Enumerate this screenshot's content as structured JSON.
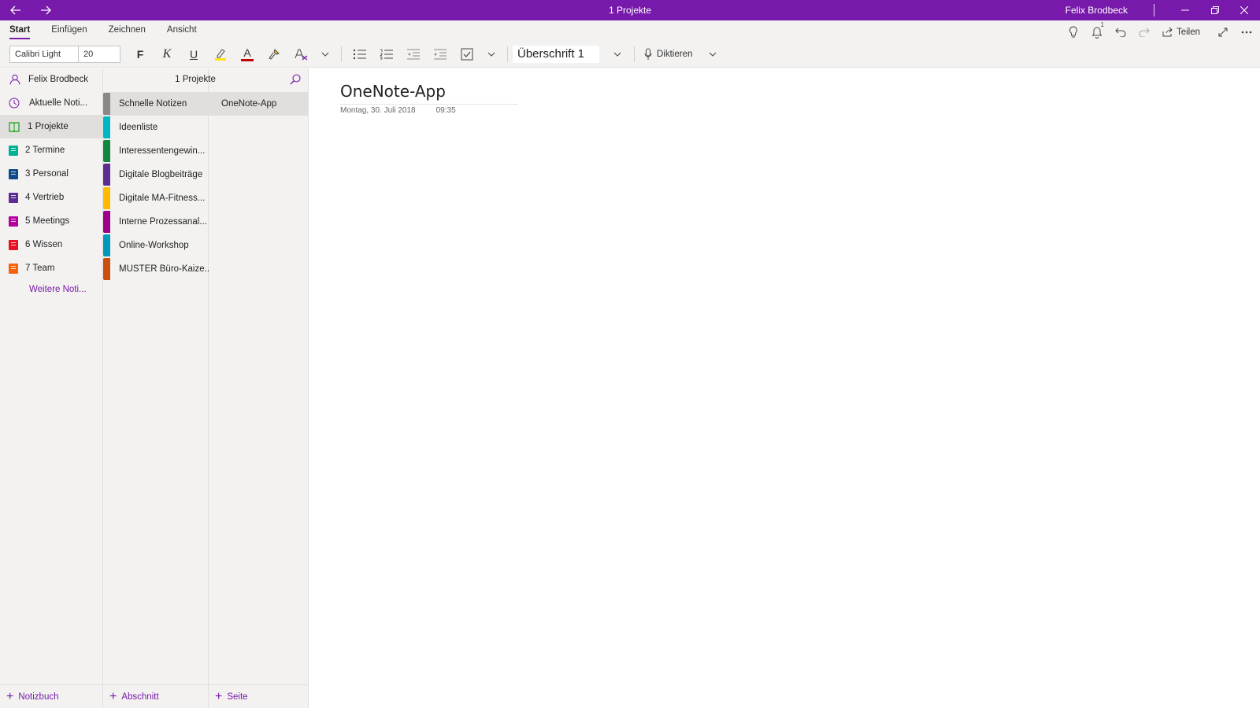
{
  "window": {
    "title": "1 Projekte",
    "user": "Felix Brodbeck"
  },
  "ribbon": {
    "tabs": [
      {
        "label": "Start",
        "active": true
      },
      {
        "label": "Einfügen"
      },
      {
        "label": "Zeichnen"
      },
      {
        "label": "Ansicht"
      }
    ],
    "share_label": "Teilen",
    "notification_count": "1",
    "font_name": "Calibri Light",
    "font_size": "20",
    "bold_label": "F",
    "italic_label": "K",
    "underline_label": "U",
    "font_color_label": "A",
    "paragraph_style": "Überschrift 1",
    "dictate_label": "Diktieren",
    "accent_color": "#7719aa"
  },
  "notebooks": {
    "user": "Felix Brodbeck",
    "items": [
      {
        "label": "Aktuelle Noti...",
        "icon": "clock-icon"
      },
      {
        "label": "1 Projekte",
        "color": "#13a10e",
        "active": true
      },
      {
        "label": "2 Termine",
        "color": "#00b294"
      },
      {
        "label": "3 Personal",
        "color": "#0f4a8a"
      },
      {
        "label": "4 Vertrieb",
        "color": "#5c2d91"
      },
      {
        "label": "5 Meetings",
        "color": "#b4009e"
      },
      {
        "label": "6 Wissen",
        "color": "#e81123"
      },
      {
        "label": "7 Team",
        "color": "#f7630c"
      }
    ],
    "more_label": "Weitere Noti...",
    "add_label": "Notizbuch"
  },
  "sections": {
    "header": "1 Projekte",
    "items": [
      {
        "label": "Schnelle Notizen",
        "color": "#8a8886",
        "active": true
      },
      {
        "label": "Ideenliste",
        "color": "#00b7c3"
      },
      {
        "label": "Interessentengewin...",
        "color": "#10893e"
      },
      {
        "label": "Digitale Blogbeiträge",
        "color": "#5c2d91"
      },
      {
        "label": "Digitale MA-Fitness...",
        "color": "#ffb900"
      },
      {
        "label": "Interne Prozessanal...",
        "color": "#9a0089"
      },
      {
        "label": "Online-Workshop",
        "color": "#0099bc"
      },
      {
        "label": "MUSTER Büro-Kaize...",
        "color": "#ca5010"
      }
    ],
    "add_label": "Abschnitt"
  },
  "pages": {
    "items": [
      {
        "label": "OneNote-App",
        "active": true
      }
    ],
    "add_label": "Seite"
  },
  "canvas": {
    "title": "OneNote-App",
    "date": "Montag, 30. Juli 2018",
    "time": "09:35"
  }
}
